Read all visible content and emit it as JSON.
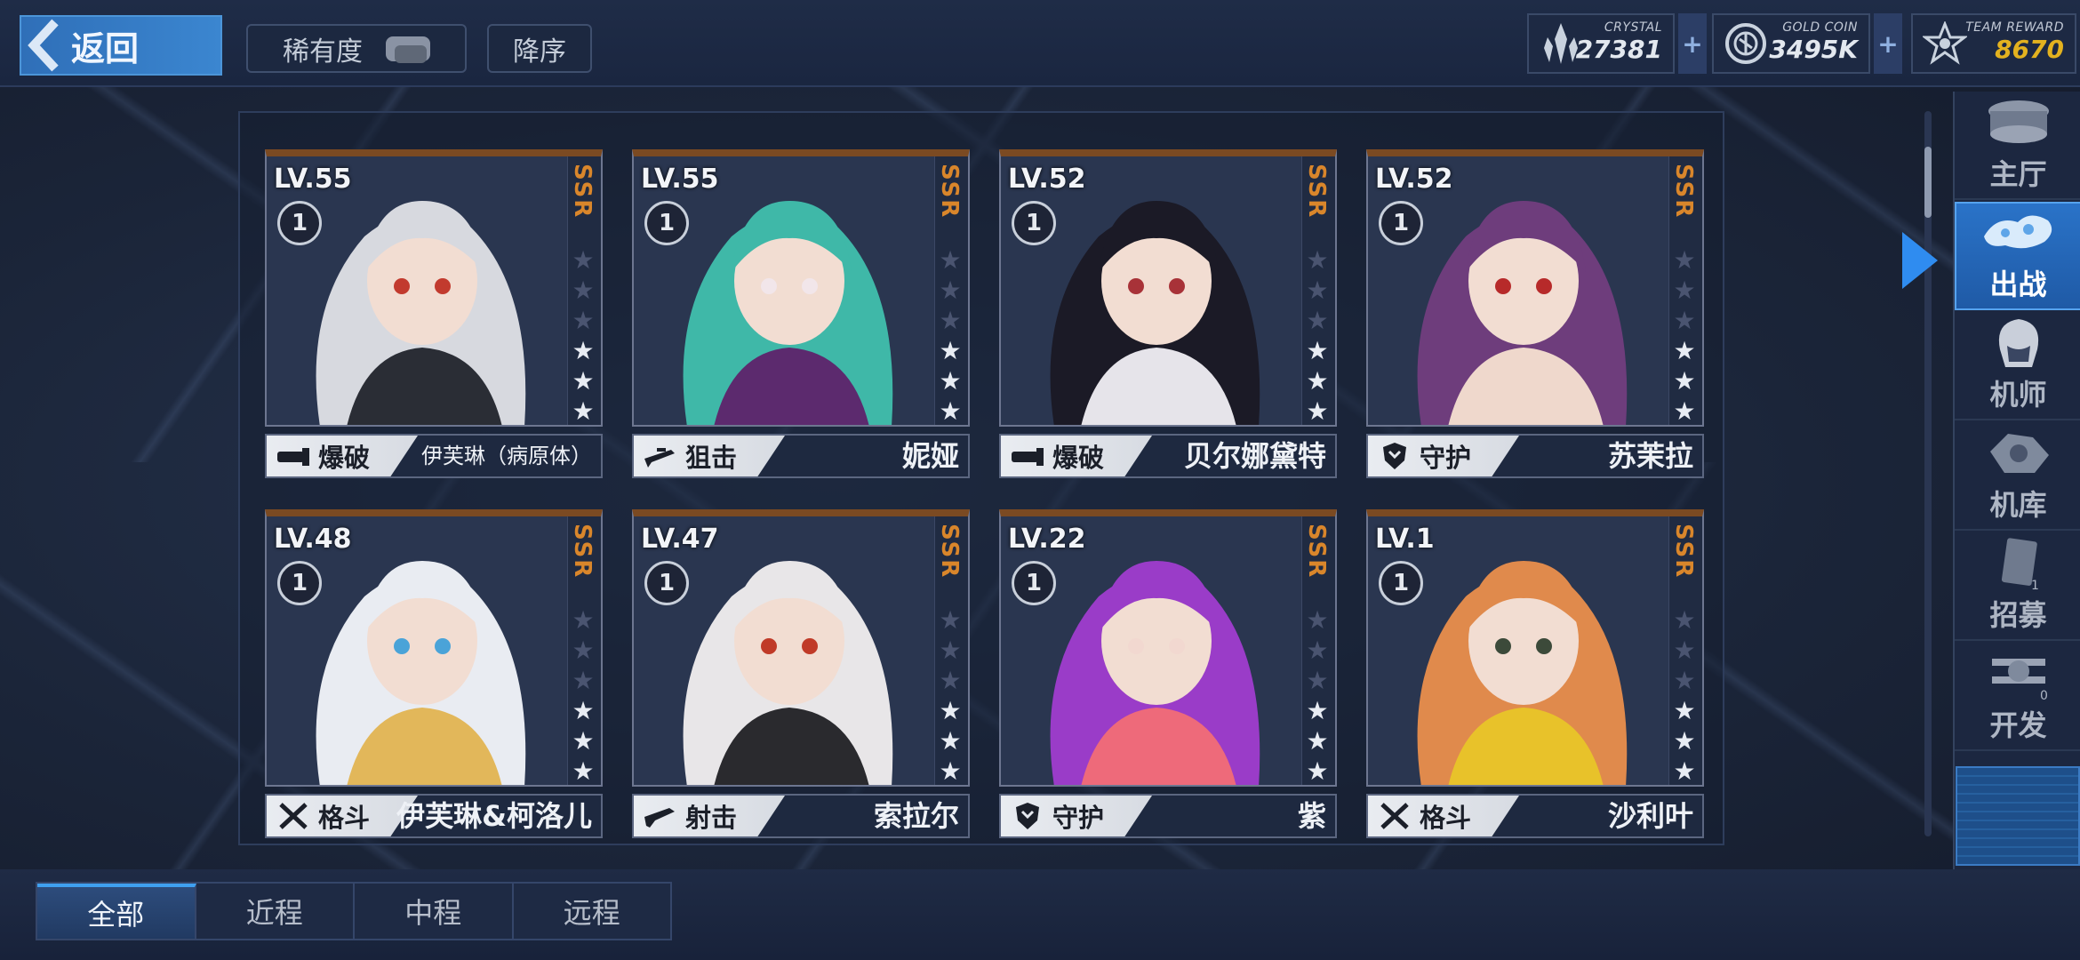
{
  "header": {
    "back_label": "返回",
    "sort_rarity_label": "稀有度",
    "sort_order_label": "降序",
    "currencies": [
      {
        "name": "CRYSTAL",
        "value": "27381",
        "icon": "crystal-icon"
      },
      {
        "name": "GOLD COIN",
        "value": "3495K",
        "icon": "gold-coin-icon"
      },
      {
        "name": "TEAM REWARD",
        "value": "8670",
        "icon": "team-reward-icon",
        "color": "#e3b21f"
      }
    ],
    "plus_label": "+"
  },
  "cards": [
    {
      "level": "LV.55",
      "rank": "1",
      "rarity": "SSR",
      "stars": 3,
      "role": "爆破",
      "name": "伊芙琳（病原体）",
      "palette": [
        "#d7d9df",
        "#2a2d35",
        "#c23a2e"
      ]
    },
    {
      "level": "LV.55",
      "rank": "1",
      "rarity": "SSR",
      "stars": 3,
      "role": "狙击",
      "name": "妮娅",
      "palette": [
        "#3fb8a8",
        "#5c2a6e",
        "#f2e6ea"
      ]
    },
    {
      "level": "LV.52",
      "rank": "1",
      "rarity": "SSR",
      "stars": 3,
      "role": "爆破",
      "name": "贝尔娜黛特",
      "palette": [
        "#1b1a26",
        "#e6e4ea",
        "#a83238"
      ]
    },
    {
      "level": "LV.52",
      "rank": "1",
      "rarity": "SSR",
      "stars": 3,
      "role": "守护",
      "name": "苏茉拉",
      "palette": [
        "#6e3d7c",
        "#efd8cc",
        "#b72a2a"
      ]
    },
    {
      "level": "LV.48",
      "rank": "1",
      "rarity": "SSR",
      "stars": 3,
      "role": "格斗",
      "name": "伊芙琳&柯洛儿",
      "palette": [
        "#e9ecf2",
        "#e2b75a",
        "#4aa3d8"
      ]
    },
    {
      "level": "LV.47",
      "rank": "1",
      "rarity": "SSR",
      "stars": 3,
      "role": "射击",
      "name": "索拉尔",
      "palette": [
        "#e8e6e8",
        "#2a2a2e",
        "#c03a28"
      ]
    },
    {
      "level": "LV.22",
      "rank": "1",
      "rarity": "SSR",
      "stars": 3,
      "role": "守护",
      "name": "紫",
      "palette": [
        "#9a3cc8",
        "#ee6a7a",
        "#f2d8d0"
      ]
    },
    {
      "level": "LV.1",
      "rank": "1",
      "rarity": "SSR",
      "stars": 3,
      "role": "格斗",
      "name": "沙利叶",
      "palette": [
        "#e08a4c",
        "#e8c22a",
        "#3c4a3a"
      ]
    }
  ],
  "nav": [
    {
      "label": "主厅",
      "icon": "main-hall-icon"
    },
    {
      "label": "出战",
      "icon": "sortie-icon",
      "active": true
    },
    {
      "label": "机师",
      "icon": "pilot-icon"
    },
    {
      "label": "机库",
      "icon": "hangar-icon"
    },
    {
      "label": "招募",
      "icon": "recruit-icon"
    },
    {
      "label": "开发",
      "icon": "develop-icon"
    }
  ],
  "nav_badges": {
    "recruit": "1",
    "develop": "0"
  },
  "tabs": [
    {
      "label": "全部",
      "active": true
    },
    {
      "label": "近程"
    },
    {
      "label": "中程"
    },
    {
      "label": "远程"
    }
  ]
}
